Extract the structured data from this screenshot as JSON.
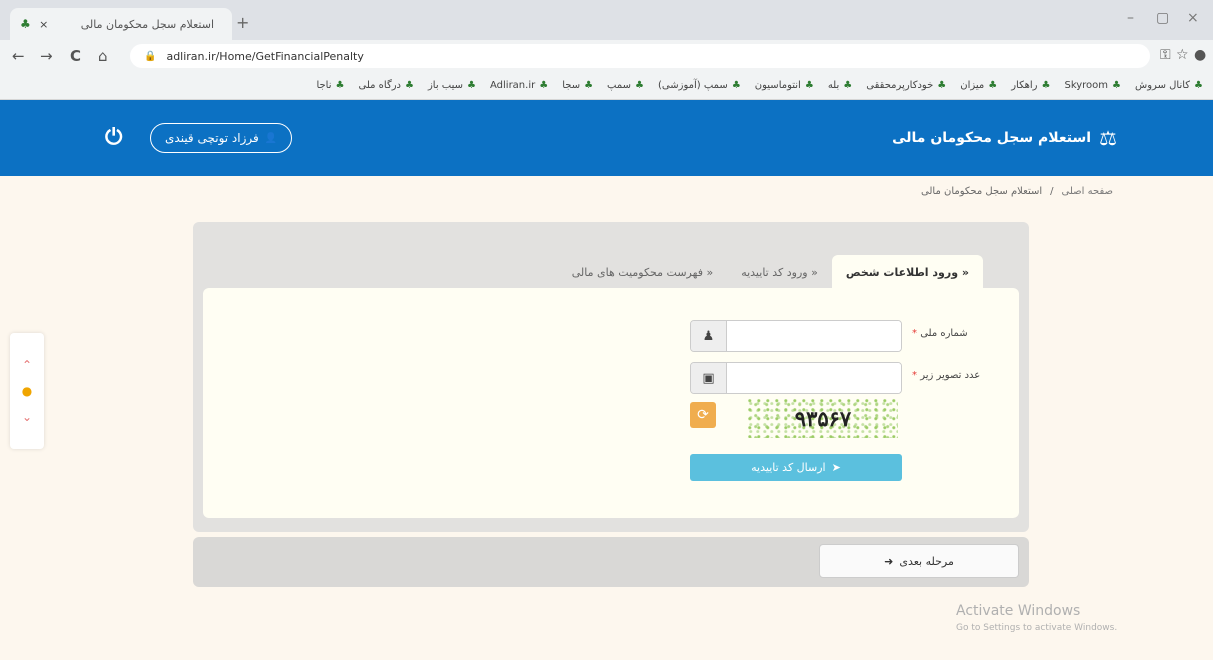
{
  "browser": {
    "tab_title": "استعلام سجل محکومان مالی",
    "tab_close": "×",
    "new_tab": "+",
    "window": {
      "minimize": "–",
      "maximize": "▢",
      "close": "×"
    },
    "nav": {
      "back": "←",
      "forward": "→",
      "reload": "C",
      "home": "⌂"
    },
    "url": "adliran.ir/Home/GetFinancialPenalty",
    "bookmarks": [
      "کانال سروش",
      "Skyroom",
      "راهکار",
      "میزان",
      "خودکارپرمحققی",
      "بله",
      "انتوماسیون",
      "سمپ (آموزشی)",
      "سمپ",
      "سجا",
      "Adliran.ir",
      "سیب باز",
      "درگاه ملی",
      "ناجا"
    ]
  },
  "site": {
    "brand_title": "استعلام سجل محکومان مالی",
    "brand_icon": "⚖",
    "user_name": "فرزاد توتچی قیندی",
    "user_icon": "👤",
    "power_icon": "⏻"
  },
  "breadcrumb": {
    "home": "صفحه اصلی",
    "separator": "/",
    "current": "استعلام سجل محکومان مالی"
  },
  "wizard": {
    "tabs": [
      {
        "label": "ورود اطلاعات شخص »",
        "active": true
      },
      {
        "label": "ورود کد تاییدیه »",
        "active": false
      },
      {
        "label": "فهرست محکومیت های مالی »",
        "active": false
      }
    ],
    "national_id": {
      "label": "شماره ملی",
      "required": "*",
      "value": "",
      "icon": "user-icon"
    },
    "captcha_field": {
      "label": "عدد تصویر زیر",
      "required": "*",
      "value": "",
      "icon": "image-icon"
    },
    "captcha_text": "۹۳۵۶۷",
    "send_button": "ارسال کد تاییدیه",
    "next_button": "مرحله بعدی"
  },
  "watermark": {
    "title": "Activate Windows",
    "subtitle": "Go to Settings to activate Windows."
  },
  "colors": {
    "header": "#0c71c3",
    "send_button": "#5bc0de",
    "refresh_button": "#f0ad4e"
  }
}
